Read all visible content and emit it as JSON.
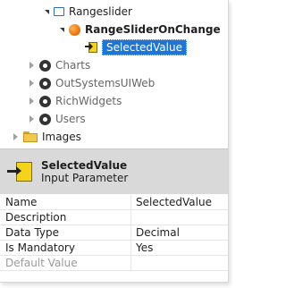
{
  "tree": {
    "items": [
      {
        "label": "Rangeslider",
        "icon": "web-block-icon",
        "state": "expanded"
      },
      {
        "label": "RangeSliderOnChange",
        "icon": "client-action-icon",
        "state": "expanded"
      },
      {
        "label": "SelectedValue",
        "icon": "input-parameter-icon",
        "state": "selected"
      },
      {
        "label": "Charts",
        "icon": "module-icon",
        "state": "collapsed"
      },
      {
        "label": "OutSystemsUIWeb",
        "icon": "module-icon",
        "state": "collapsed"
      },
      {
        "label": "RichWidgets",
        "icon": "module-icon",
        "state": "collapsed"
      },
      {
        "label": "Users",
        "icon": "module-icon",
        "state": "collapsed"
      },
      {
        "label": "Images",
        "icon": "folder-icon",
        "state": "collapsed"
      }
    ]
  },
  "header": {
    "title": "SelectedValue",
    "subtitle": "Input Parameter"
  },
  "properties": [
    {
      "name": "Name",
      "value": "SelectedValue"
    },
    {
      "name": "Description",
      "value": ""
    },
    {
      "name": "Data Type",
      "value": "Decimal"
    },
    {
      "name": "Is Mandatory",
      "value": "Yes"
    },
    {
      "name": "Default Value",
      "value": ""
    }
  ],
  "colors": {
    "selection": "#1d76d6",
    "header_bg": "#d9d9d9",
    "param_icon": "#f5d31a",
    "action_icon": "#f07a10"
  }
}
